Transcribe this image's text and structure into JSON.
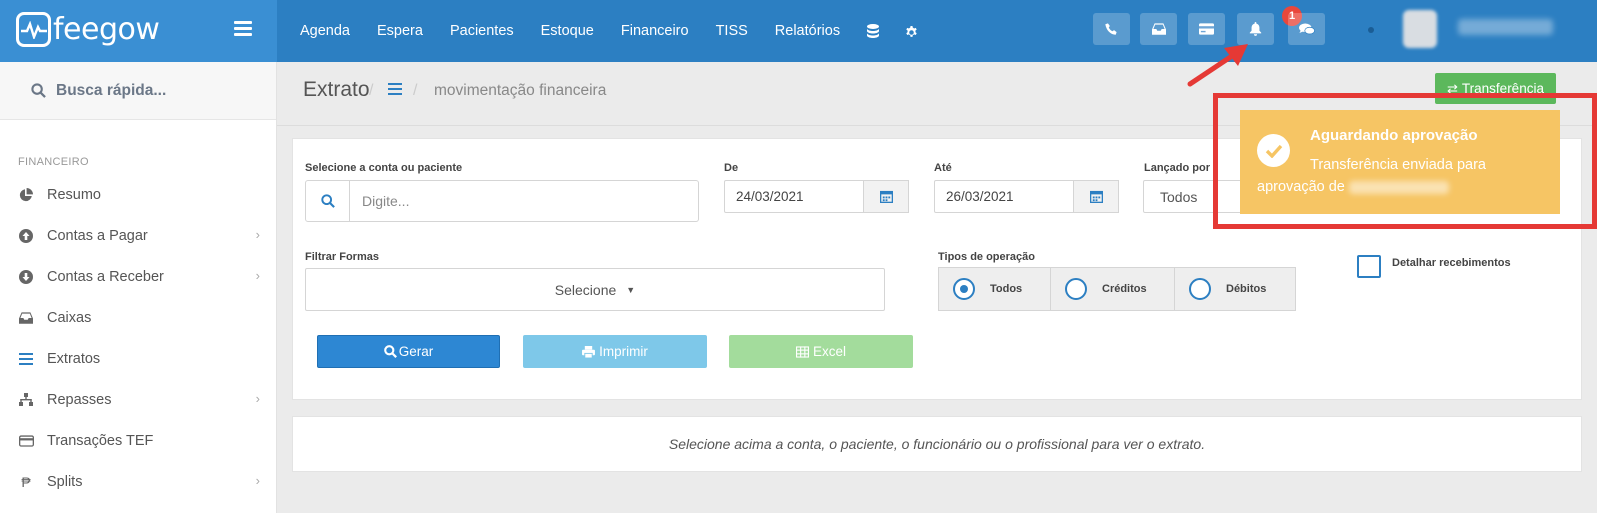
{
  "brand": {
    "name": "feegow"
  },
  "nav": {
    "items": [
      "Agenda",
      "Espera",
      "Pacientes",
      "Estoque",
      "Financeiro",
      "TISS",
      "Relatórios"
    ],
    "icons": [
      "database-icon",
      "gear-icon"
    ]
  },
  "topbar": {
    "buttons": [
      "phone-icon",
      "inbox-icon",
      "card-icon",
      "bell-icon",
      "chat-icon"
    ],
    "notification_count": "1"
  },
  "sidebar": {
    "search_placeholder": "Busca rápida...",
    "section": "FINANCEIRO",
    "items": [
      {
        "label": "Resumo",
        "icon": "pie-chart-icon",
        "has_submenu": false
      },
      {
        "label": "Contas a Pagar",
        "icon": "arrow-up-circle-icon",
        "has_submenu": true
      },
      {
        "label": "Contas a Receber",
        "icon": "arrow-down-circle-icon",
        "has_submenu": true
      },
      {
        "label": "Caixas",
        "icon": "inbox-icon",
        "has_submenu": false
      },
      {
        "label": "Extratos",
        "icon": "list-icon",
        "has_submenu": false
      },
      {
        "label": "Repasses",
        "icon": "sitemap-icon",
        "has_submenu": true
      },
      {
        "label": "Transações TEF",
        "icon": "credit-card-icon",
        "has_submenu": false
      },
      {
        "label": "Splits",
        "icon": "split-icon",
        "has_submenu": true
      }
    ]
  },
  "page": {
    "title": "Extrato",
    "breadcrumb": "movimentação financeira",
    "transfer_button": "Transferência"
  },
  "form": {
    "account_label": "Selecione a conta ou paciente",
    "account_placeholder": "Digite...",
    "from_label": "De",
    "from_value": "24/03/2021",
    "to_label": "Até",
    "to_value": "26/03/2021",
    "launched_by_label": "Lançado por",
    "launched_by_value": "Todos",
    "forms_label": "Filtrar Formas",
    "forms_value": "Selecione",
    "operation_label": "Tipos de operação",
    "operations": [
      {
        "label": "Todos",
        "selected": true
      },
      {
        "label": "Créditos",
        "selected": false
      },
      {
        "label": "Débitos",
        "selected": false
      }
    ],
    "detail_label": "Detalhar recebimentos",
    "generate_button": "Gerar",
    "print_button": "Imprimir",
    "excel_button": "Excel"
  },
  "info": {
    "message": "Selecione acima a conta, o paciente, o funcionário ou o profissional para ver o extrato."
  },
  "toast": {
    "title": "Aguardando aprovação",
    "message": "Transferência enviada para aprovação de"
  },
  "colors": {
    "primary": "#2c7fc2",
    "success": "#5cb85c",
    "warning": "#f6c564",
    "highlight": "#e53935"
  }
}
